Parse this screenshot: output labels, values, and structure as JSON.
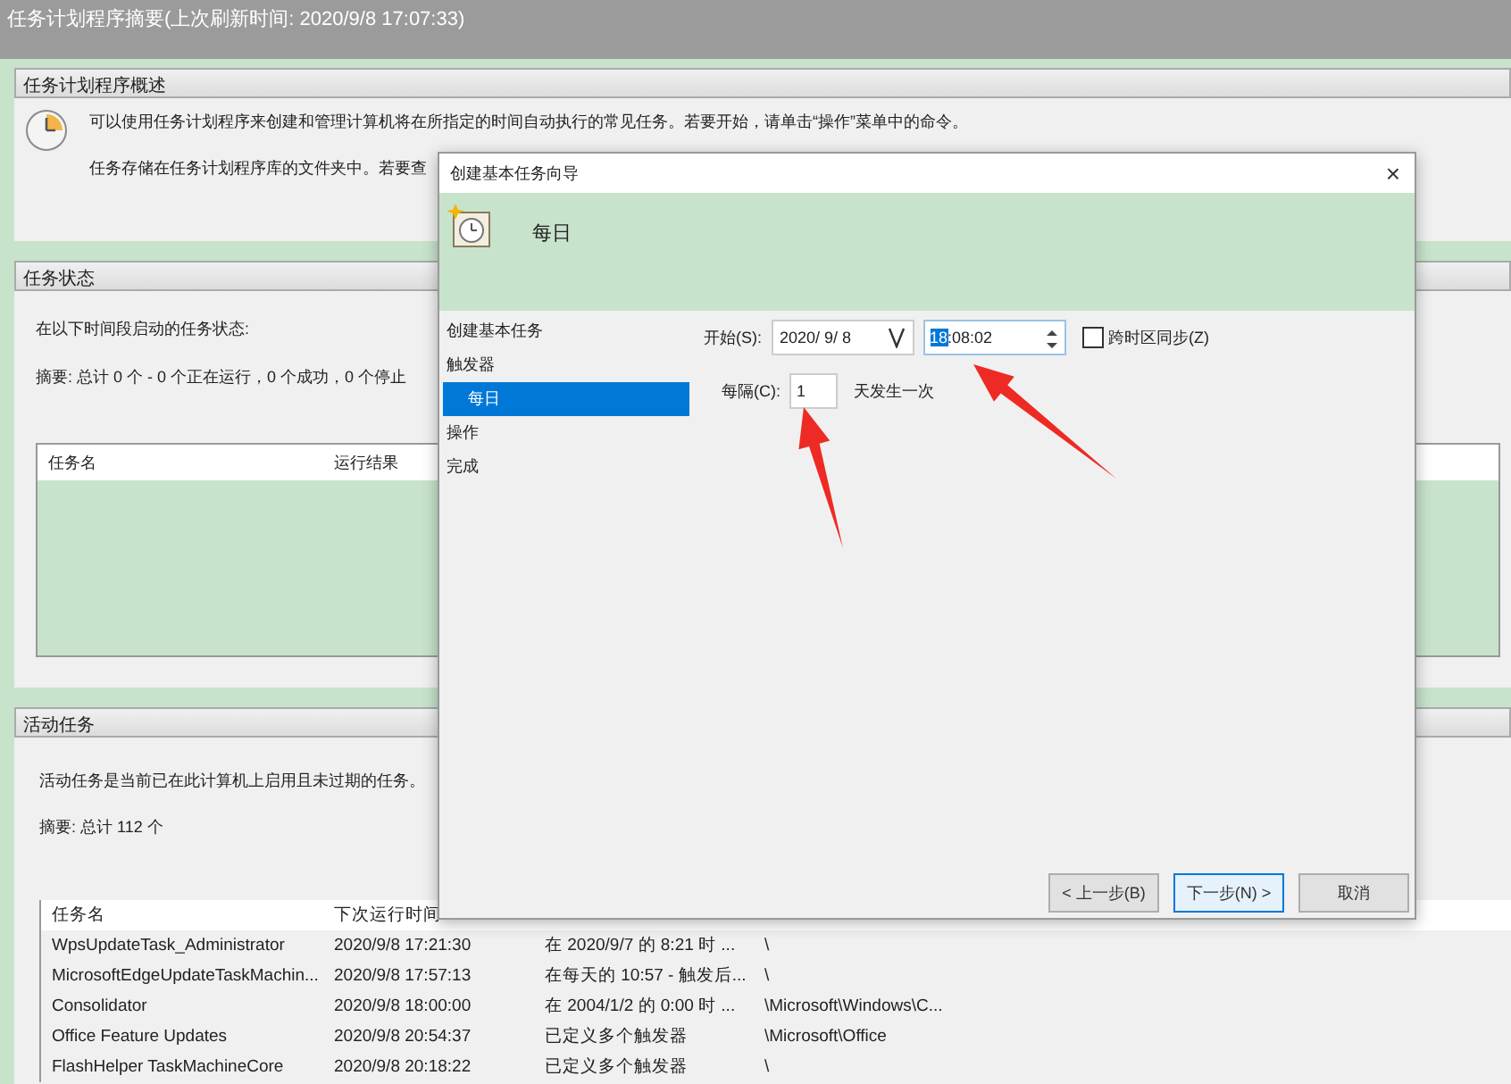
{
  "window": {
    "title": "任务计划程序摘要(上次刷新时间: 2020/9/8 17:07:33)"
  },
  "overview": {
    "title": "任务计划程序概述",
    "text": "可以使用任务计划程序来创建和管理计算机将在所指定的时间自动执行的常见任务。若要开始，请单击“操作”菜单中的命令。",
    "text2": "任务存储在任务计划程序库的文件夹中。若要查"
  },
  "task_status": {
    "title": "任务状态",
    "label": "在以下时间段启动的任务状态:",
    "summary": "摘要: 总计 0 个 - 0 个正在运行，0 个成功，0 个停止",
    "columns": [
      "任务名",
      "运行结果"
    ]
  },
  "active_tasks": {
    "title": "活动任务",
    "text": "活动任务是当前已在此计算机上启用且未过期的任务。",
    "summary": "摘要: 总计 112 个",
    "columns": [
      "任务名",
      "下次运行时间"
    ],
    "rows": [
      [
        "WpsUpdateTask_Administrator",
        "2020/9/8 17:21:30",
        "在 2020/9/7 的 8:21 时 ...",
        "\\"
      ],
      [
        "MicrosoftEdgeUpdateTaskMachin...",
        "2020/9/8 17:57:13",
        "在每天的 10:57 - 触发后...",
        "\\"
      ],
      [
        "Consolidator",
        "2020/9/8 18:00:00",
        "在 2004/1/2 的 0:00 时 ...",
        "\\Microsoft\\Windows\\C..."
      ],
      [
        "Office Feature Updates",
        "2020/9/8 20:54:37",
        "已定义多个触发器",
        "\\Microsoft\\Office"
      ],
      [
        "FlashHelper TaskMachineCore",
        "2020/9/8 20:18:22",
        "已定义多个触发器",
        "\\"
      ]
    ]
  },
  "dialog": {
    "title": "创建基本任务向导",
    "close": "×",
    "heading": "每日",
    "steps": [
      {
        "label": "创建基本任务",
        "selected": false
      },
      {
        "label": "触发器",
        "selected": false,
        "children": [
          {
            "label": "每日",
            "selected": true
          }
        ]
      },
      {
        "label": "操作",
        "selected": false
      },
      {
        "label": "完成",
        "selected": false
      }
    ],
    "start_label": "开始(S):",
    "date": "2020/  9/  8",
    "time_hour": "18",
    "time_rest": ":08:02",
    "sync": {
      "label": "跨时区同步(Z)",
      "checked": false
    },
    "recur_label": "每隔(C):",
    "recur_value": "1",
    "recur_suffix": "天发生一次",
    "buttons": [
      {
        "label": "< 上一步(B)",
        "focused": false
      },
      {
        "label": "下一步(N) >",
        "focused": true
      },
      {
        "label": "取消",
        "focused": false
      }
    ]
  }
}
